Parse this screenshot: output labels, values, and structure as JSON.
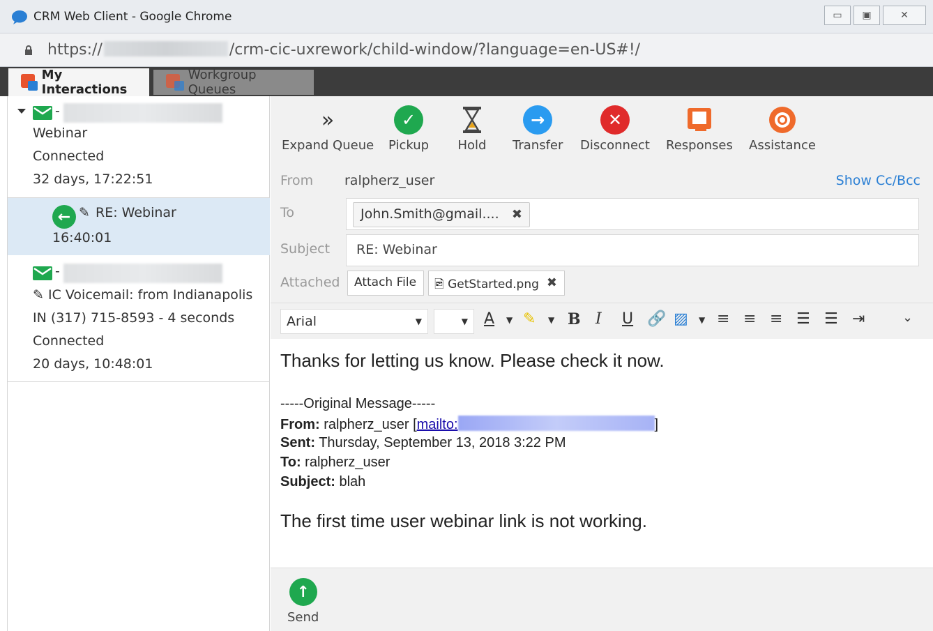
{
  "window": {
    "title": "CRM Web Client - Google Chrome",
    "url_prefix": "https://",
    "url_suffix": "/crm-cic-uxrework/child-window/?language=en-US#!/"
  },
  "app_tabs": [
    {
      "label": "My Interactions"
    },
    {
      "label": "Workgroup Queues"
    }
  ],
  "interactions": [
    {
      "type": "Webinar",
      "state": "Connected",
      "duration": "32 days, 17:22:51"
    },
    {
      "subject": "RE: Webinar",
      "time": "16:40:01"
    },
    {
      "subject": "IC Voicemail: from Indianapolis",
      "subject2": "IN (317) 715-8593 - 4 seconds",
      "state": "Connected",
      "duration": "20 days, 10:48:01"
    }
  ],
  "toolbar": {
    "expand_queue": "Expand Queue",
    "pickup": "Pickup",
    "hold": "Hold",
    "transfer": "Transfer",
    "disconnect": "Disconnect",
    "responses": "Responses",
    "assistance": "Assistance"
  },
  "form": {
    "from_label": "From",
    "from_value": "ralpherz_user",
    "show_cc": "Show Cc/Bcc",
    "to_label": "To",
    "to_chip": "John.Smith@gmail....",
    "subject_label": "Subject",
    "subject_value": "RE: Webinar",
    "attached_label": "Attached",
    "attach_button": "Attach File",
    "attachment": "GetStarted.png"
  },
  "format": {
    "font": "Arial"
  },
  "body": {
    "line1": "Thanks for letting us know.  Please check it now.",
    "orig_header": "-----Original Message-----",
    "from_label": "From:",
    "from_value": "ralpherz_user [",
    "mailto": "mailto:",
    "from_close": "]",
    "sent_label": "Sent:",
    "sent_value": "Thursday, September 13, 2018 3:22 PM",
    "to_label": "To:",
    "to_value": "ralpherz_user",
    "subject_label": "Subject:",
    "subject_value": "blah",
    "line2": "The first time user webinar link is not working."
  },
  "send": {
    "label": "Send"
  },
  "colors": {
    "green": "#1fa84f",
    "blue": "#2a9bf0",
    "red": "#e02b2b",
    "orange": "#ef6a2b",
    "link": "#2a7fd4"
  }
}
